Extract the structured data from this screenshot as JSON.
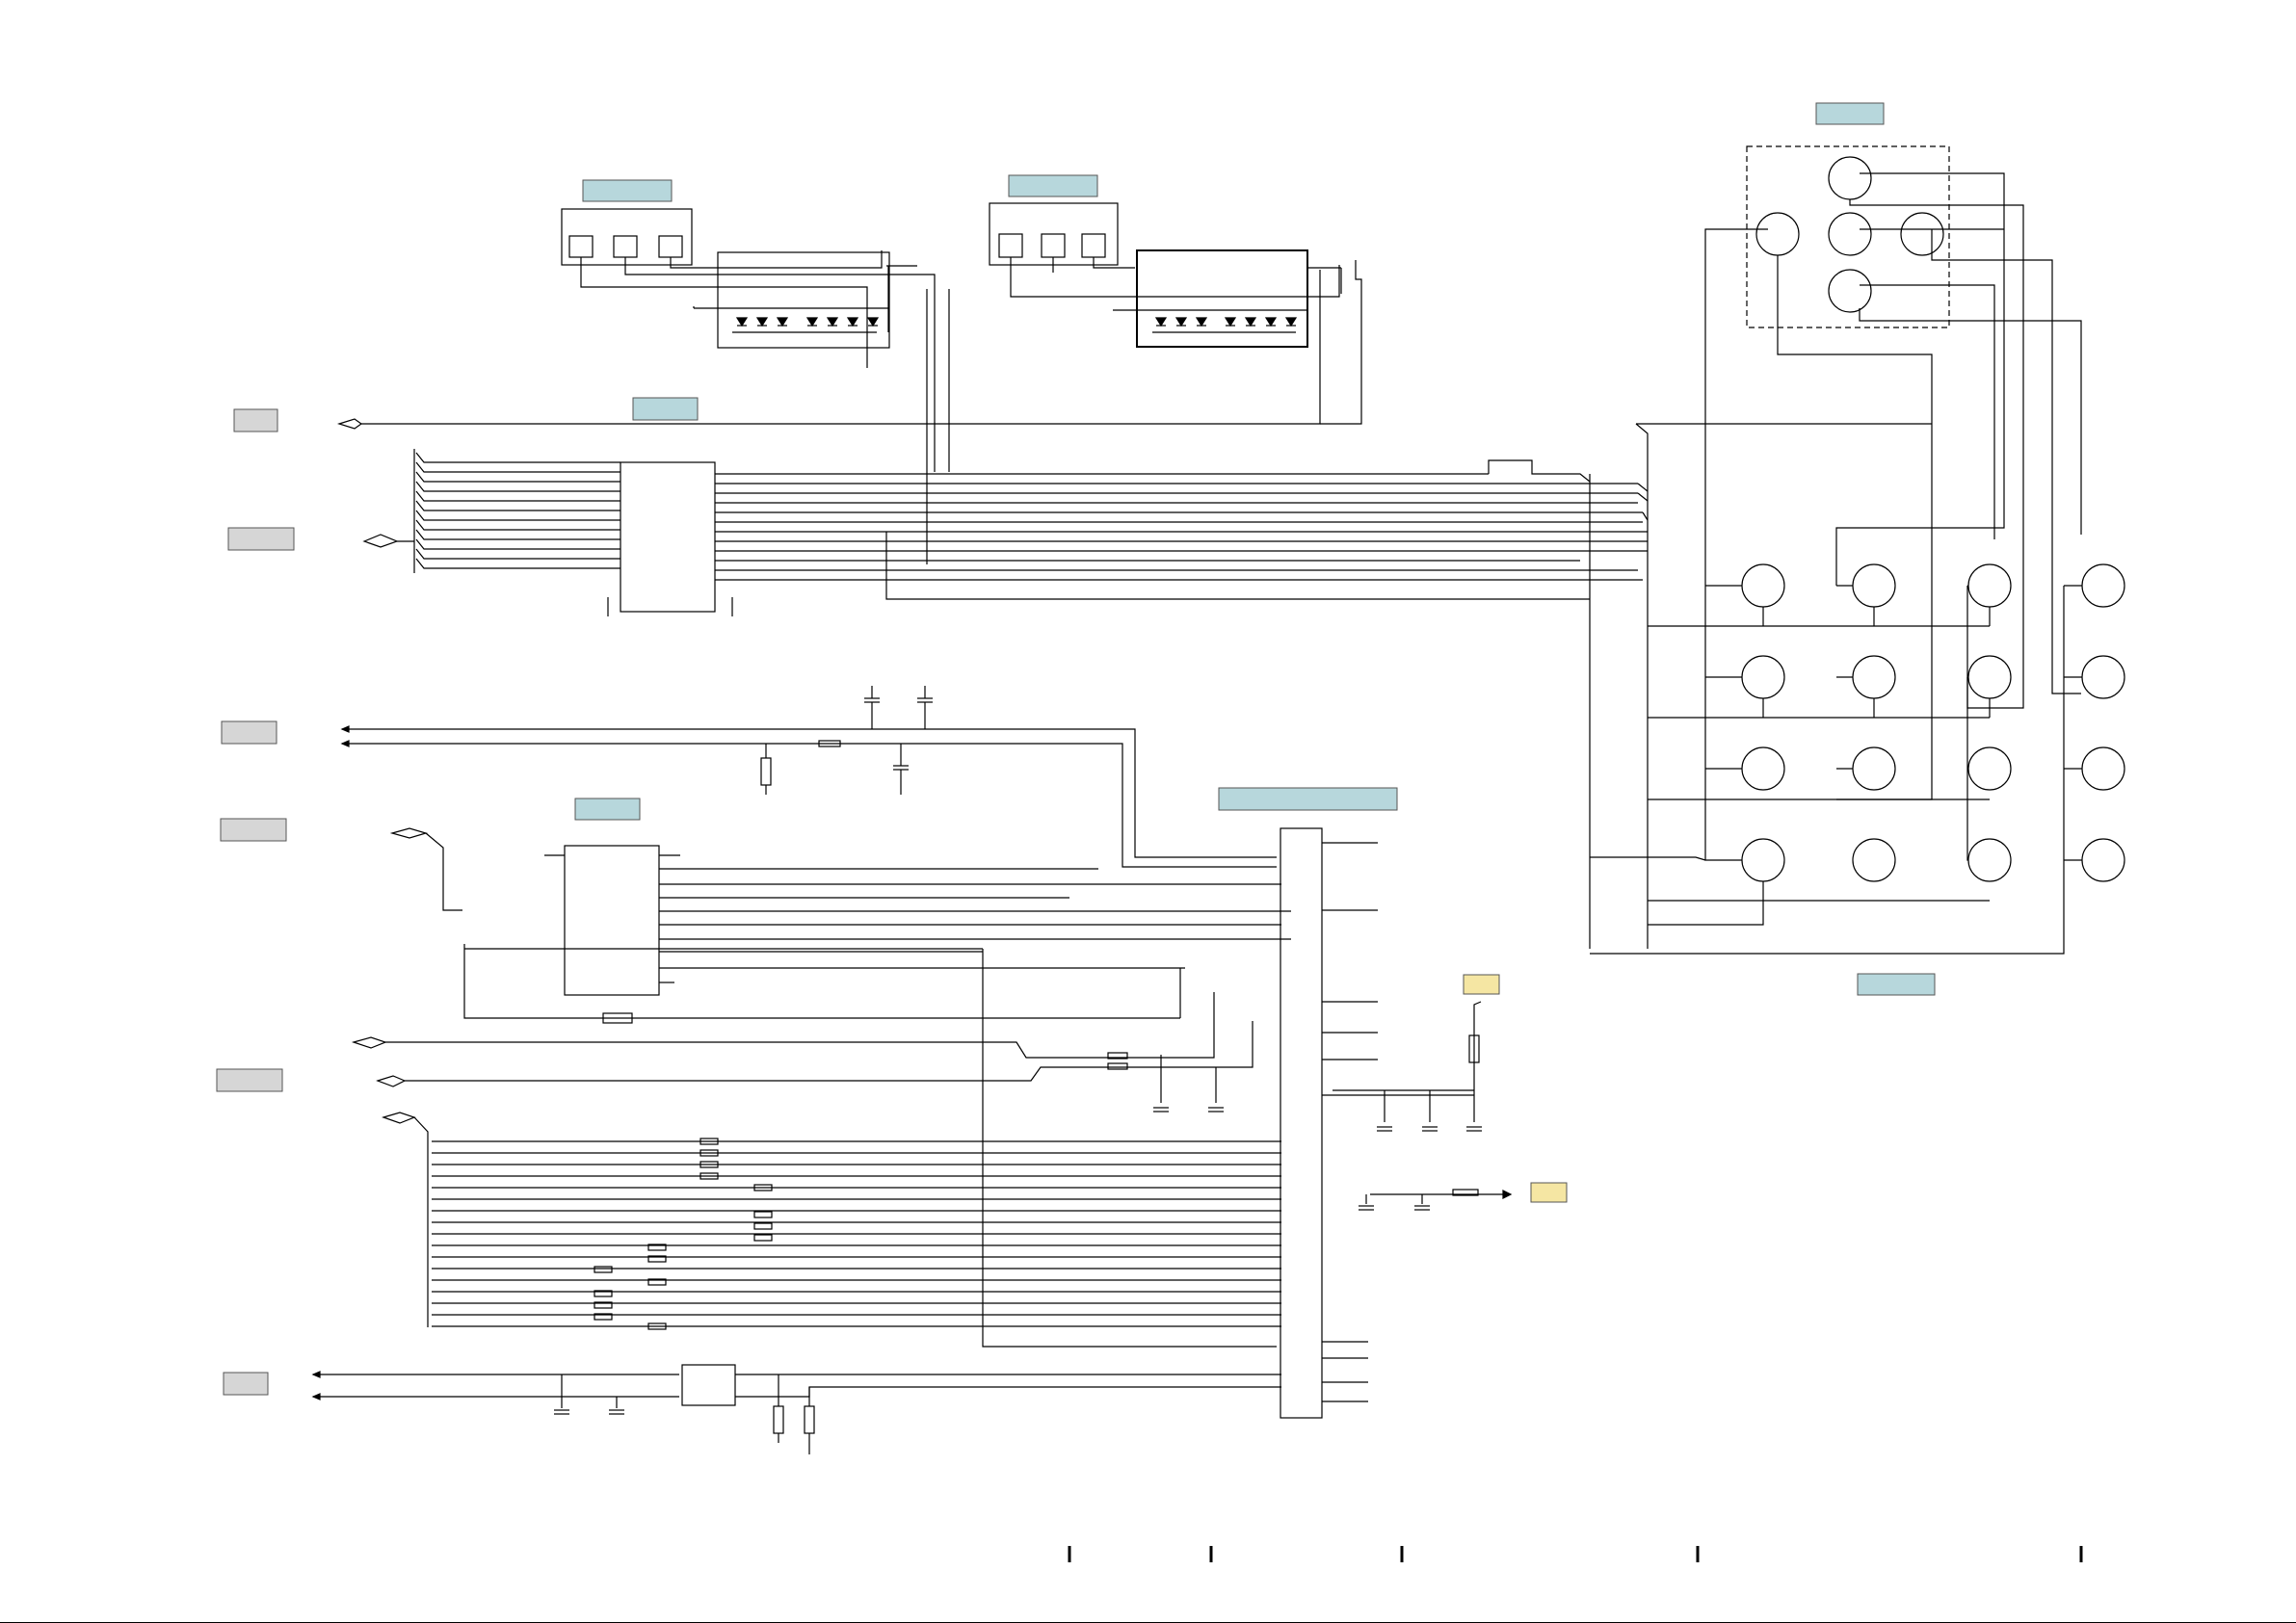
{
  "diagram": {
    "colors": {
      "wire": "#000000",
      "label_blue": "#b7d7dc",
      "label_grey": "#d6d6d6",
      "label_yellow": "#f5e6a3",
      "background": "#ffffff"
    },
    "labels": {
      "blue": [
        "",
        "",
        "",
        "",
        "",
        "",
        ""
      ],
      "grey": [
        "",
        "",
        "",
        "",
        "",
        ""
      ],
      "yellow": [
        "",
        ""
      ]
    }
  }
}
